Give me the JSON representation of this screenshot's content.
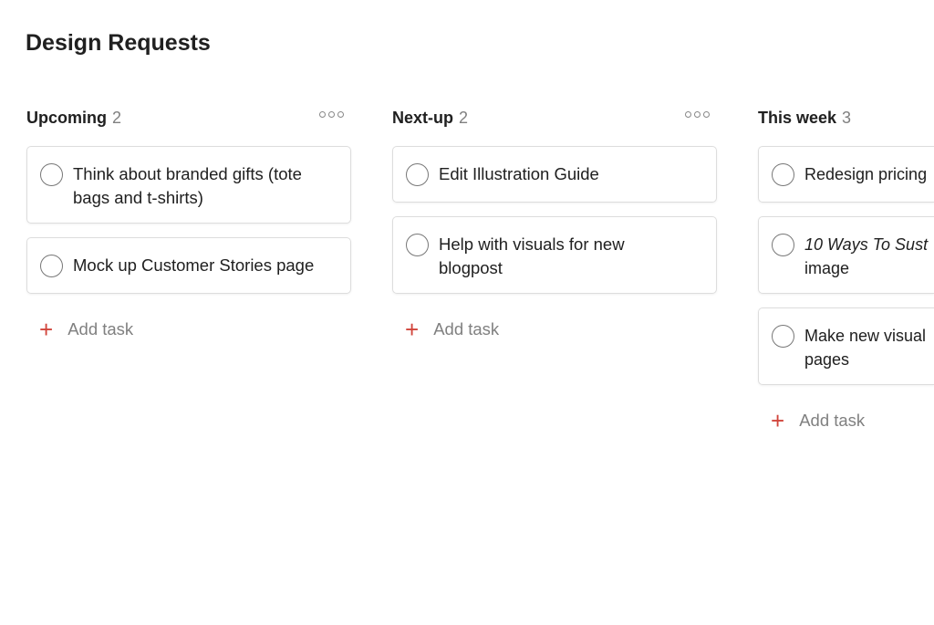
{
  "title": "Design Requests",
  "add_label": "Add task",
  "accent": "#d1453b",
  "columns": [
    {
      "name": "Upcoming",
      "count": "2",
      "cards": [
        {
          "lines": [
            "Think about branded gifts (tote",
            "bags and t-shirts)"
          ]
        },
        {
          "lines": [
            "Mock up Customer Stories page"
          ]
        }
      ]
    },
    {
      "name": "Next-up",
      "count": "2",
      "cards": [
        {
          "lines": [
            "Edit Illustration Guide"
          ]
        },
        {
          "lines": [
            "Help with visuals for new",
            "blogpost"
          ]
        }
      ]
    },
    {
      "name": "This week",
      "count": "3",
      "cards": [
        {
          "lines": [
            "Redesign pricing"
          ]
        },
        {
          "italic": "10 Ways To Sust",
          "lines": [
            "",
            "image"
          ]
        },
        {
          "lines": [
            "Make new visual",
            "pages"
          ]
        }
      ]
    }
  ]
}
